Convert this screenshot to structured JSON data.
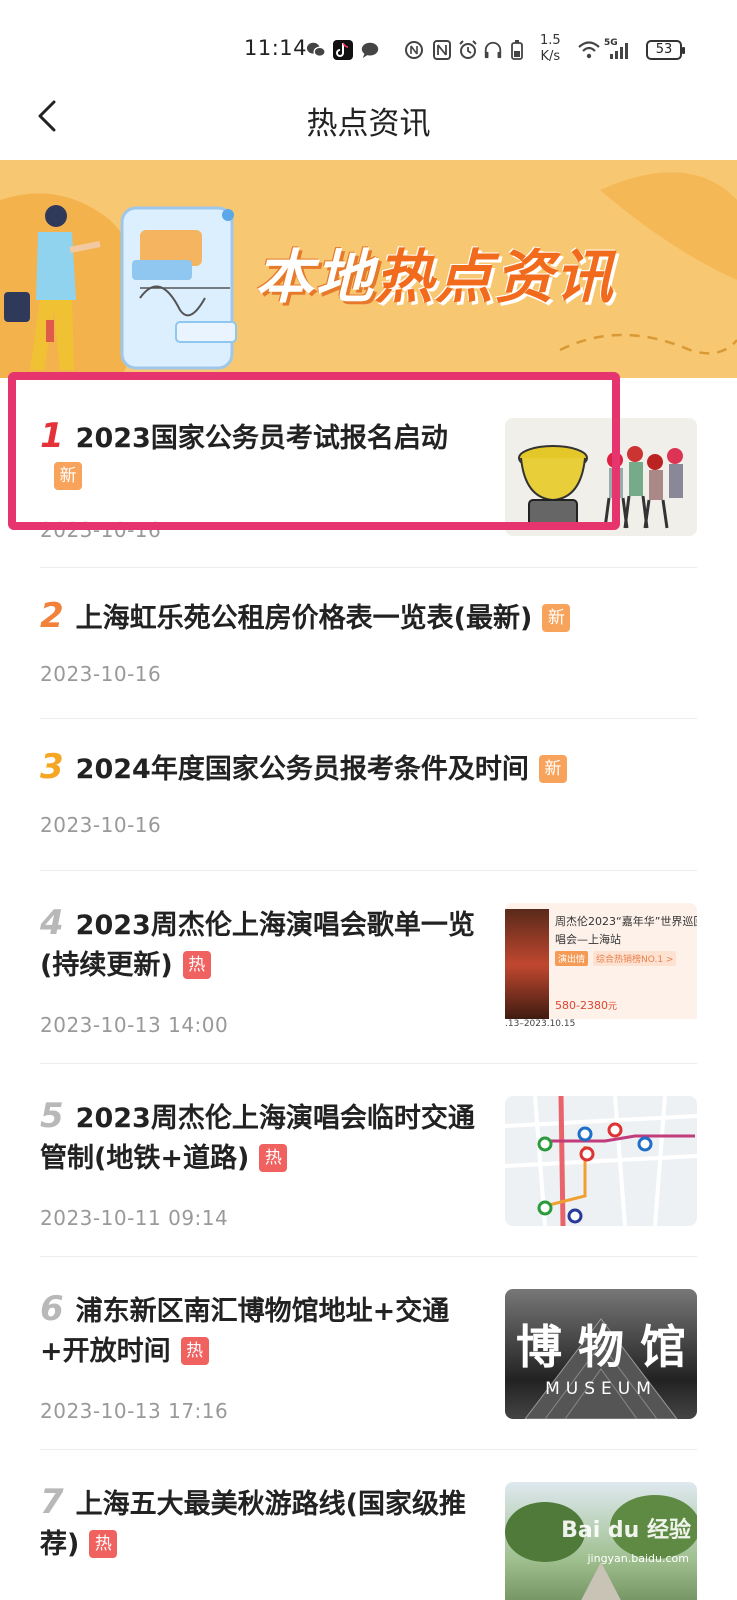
{
  "status_bar": {
    "time": "11:14",
    "net_speed_value": "1.5",
    "net_speed_unit": "K/s",
    "signal": "5G",
    "battery": "53"
  },
  "header": {
    "title": "热点资讯"
  },
  "banner": {
    "title_white": "本地",
    "title_orange": "热点资讯",
    "colors": {
      "background": "#f8c772",
      "accent": "#f26a1b"
    }
  },
  "news": [
    {
      "rank": "1",
      "title": "2023国家公务员考试报名启动",
      "badge": "新",
      "date": "2023-10-16",
      "rank_color": "#e5323a"
    },
    {
      "rank": "2",
      "title": "上海虹乐苑公租房价格表一览表(最新)",
      "badge": "新",
      "date": "2023-10-16",
      "rank_color": "#f2813a"
    },
    {
      "rank": "3",
      "title": "2024年度国家公务员报考条件及时间",
      "badge": "新",
      "date": "2023-10-16",
      "rank_color": "#f5a623"
    },
    {
      "rank": "4",
      "title": "2023周杰伦上海演唱会歌单一览(持续更新)",
      "badge": "热",
      "date": "2023-10-13 14:00",
      "rank_color": "#b8b8b8",
      "thumb": {
        "line1": "周杰伦2023“嘉年华”世界巡回",
        "line2": "唱会—上海站",
        "tag": "演出情",
        "tag2": "综合热销榜NO.1 >",
        "price": "580-2380",
        "price_unit": "元",
        "dates": ".13–2023.10.15"
      }
    },
    {
      "rank": "5",
      "title": "2023周杰伦上海演唱会临时交通管制(地铁+道路)",
      "badge": "热",
      "date": "2023-10-11 09:14",
      "rank_color": "#b8b8b8"
    },
    {
      "rank": "6",
      "title": "浦东新区南汇博物馆地址+交通+开放时间",
      "badge": "热",
      "date": "2023-10-13 17:16",
      "rank_color": "#b8b8b8",
      "thumb": {
        "big": "博 物 馆",
        "small": "MUSEUM"
      }
    },
    {
      "rank": "7",
      "title": "上海五大最美秋游路线(国家级推荐)",
      "badge": "热",
      "date": "",
      "rank_color": "#b8b8b8",
      "thumb": {
        "watermark": "Bai du 经验",
        "url": "jingyan.baidu.com"
      }
    }
  ]
}
